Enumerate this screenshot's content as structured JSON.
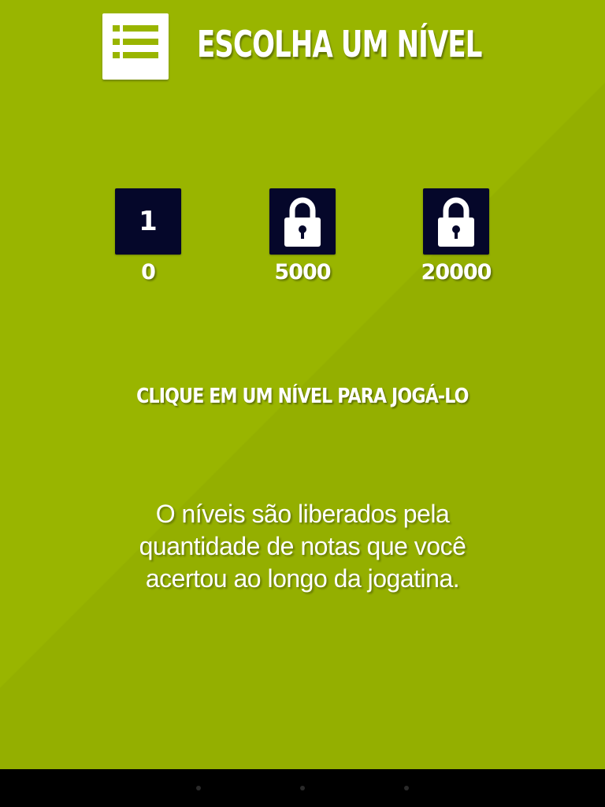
{
  "header": {
    "title": "ESCOLHA UM NÍVEL",
    "menu_icon": "list-icon"
  },
  "levels": [
    {
      "label": "1",
      "locked": false,
      "score": "0"
    },
    {
      "label": "",
      "locked": true,
      "score": "5000",
      "icon": "lock-icon"
    },
    {
      "label": "",
      "locked": true,
      "score": "20000",
      "icon": "lock-icon"
    }
  ],
  "instruction": "CLIQUE EM UM NÍVEL PARA JOGÁ-LO",
  "info": "O níveis são liberados pela quantidade de notas que você acertou ao longo da jogatina.",
  "colors": {
    "background": "#99b500",
    "tile": "#05072a",
    "text": "#ffffff",
    "nav_bar": "#000000"
  }
}
